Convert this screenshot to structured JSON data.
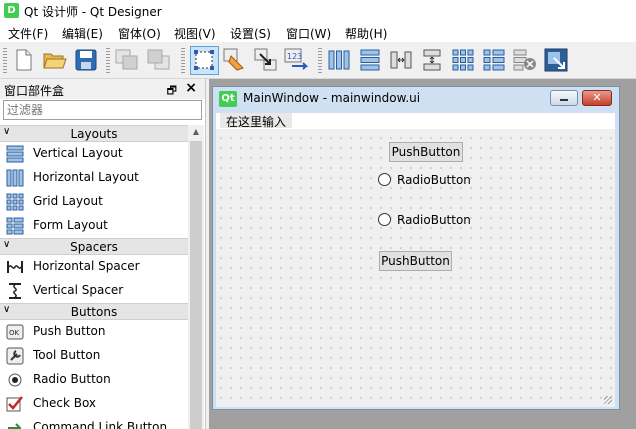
{
  "window": {
    "icon_text": "D",
    "title": "Qt 设计师 - Qt Designer"
  },
  "menubar": [
    {
      "label": "文件(F)"
    },
    {
      "label": "编辑(E)"
    },
    {
      "label": "窗体(O)"
    },
    {
      "label": "视图(V)"
    },
    {
      "label": "设置(S)"
    },
    {
      "label": "窗口(W)"
    },
    {
      "label": "帮助(H)"
    }
  ],
  "toolbar": {
    "buttons": [
      {
        "icon": "new-file-icon"
      },
      {
        "icon": "open-folder-icon"
      },
      {
        "icon": "save-icon"
      },
      {
        "icon": "send-to-back-icon"
      },
      {
        "icon": "bring-to-front-icon"
      },
      {
        "icon": "edit-widgets-icon"
      },
      {
        "icon": "edit-signals-slots-icon"
      },
      {
        "icon": "edit-buddies-icon"
      },
      {
        "icon": "edit-tab-order-icon"
      },
      {
        "icon": "layout-horizontal-icon"
      },
      {
        "icon": "layout-vertical-icon"
      },
      {
        "icon": "layout-horizontal-splitter-icon"
      },
      {
        "icon": "layout-vertical-splitter-icon"
      },
      {
        "icon": "layout-grid-icon"
      },
      {
        "icon": "layout-form-icon"
      },
      {
        "icon": "break-layout-icon"
      },
      {
        "icon": "adjust-size-icon"
      }
    ]
  },
  "widget_box": {
    "title": "窗口部件盒",
    "float_icon": "restore-icon",
    "close_icon": "close-icon",
    "filter_placeholder": "过滤器",
    "categories": [
      {
        "label": "Layouts",
        "items": [
          "Vertical Layout",
          "Horizontal Layout",
          "Grid Layout",
          "Form Layout"
        ]
      },
      {
        "label": "Spacers",
        "items": [
          "Horizontal Spacer",
          "Vertical Spacer"
        ]
      },
      {
        "label": "Buttons",
        "items": [
          "Push Button",
          "Tool Button",
          "Radio Button",
          "Check Box",
          "Command Link Button"
        ]
      }
    ]
  },
  "subwindow": {
    "logo_text": "Qt",
    "title": "MainWindow - mainwindow.ui",
    "menubar_placeholder": "在这里输入",
    "widgets": {
      "pushbutton1": "PushButton",
      "radio1": "RadioButton",
      "radio2": "RadioButton",
      "pushbutton2": "PushButton"
    }
  }
}
